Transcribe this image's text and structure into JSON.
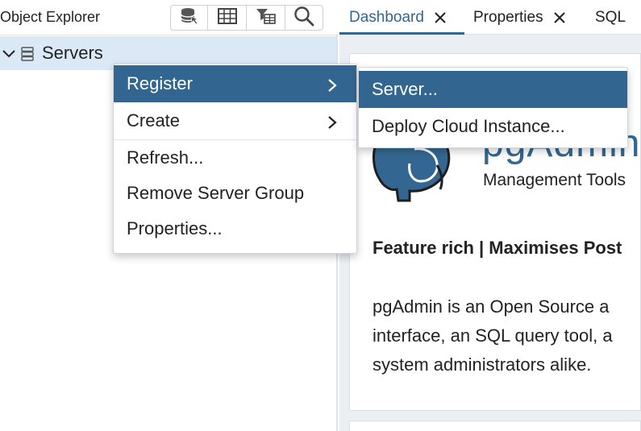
{
  "object_explorer": {
    "title": "Object Explorer",
    "toolbar": [
      {
        "icon": "database-query-icon"
      },
      {
        "icon": "table-icon"
      },
      {
        "icon": "filter-table-icon"
      },
      {
        "icon": "search-icon"
      }
    ],
    "tree": {
      "label": "Servers",
      "expanded": true
    }
  },
  "tabs": [
    {
      "label": "Dashboard",
      "active": true
    },
    {
      "label": "Properties",
      "active": false
    },
    {
      "label": "SQL",
      "active": false
    }
  ],
  "dashboard": {
    "logo_text": "pgAdmin",
    "tagline": "Management Tools",
    "feature_heading": "Feature rich | Maximises Post",
    "description_lines": [
      "pgAdmin is an Open Source a",
      "interface, an SQL query tool, a",
      "system administrators alike."
    ]
  },
  "context_menu": {
    "items": [
      {
        "label": "Register",
        "has_submenu": true,
        "selected": true
      },
      {
        "label": "Create",
        "has_submenu": true,
        "selected": false
      },
      {
        "label": "Refresh...",
        "has_submenu": false,
        "selected": false
      },
      {
        "label": "Remove Server Group",
        "has_submenu": false,
        "selected": false
      },
      {
        "label": "Properties...",
        "has_submenu": false,
        "selected": false
      }
    ]
  },
  "submenu": {
    "items": [
      {
        "label": "Server...",
        "selected": true
      },
      {
        "label": "Deploy Cloud Instance...",
        "selected": false
      }
    ]
  },
  "colors": {
    "accent": "#326690",
    "selection": "#dbe8f6",
    "logo_blue": "#336791"
  }
}
